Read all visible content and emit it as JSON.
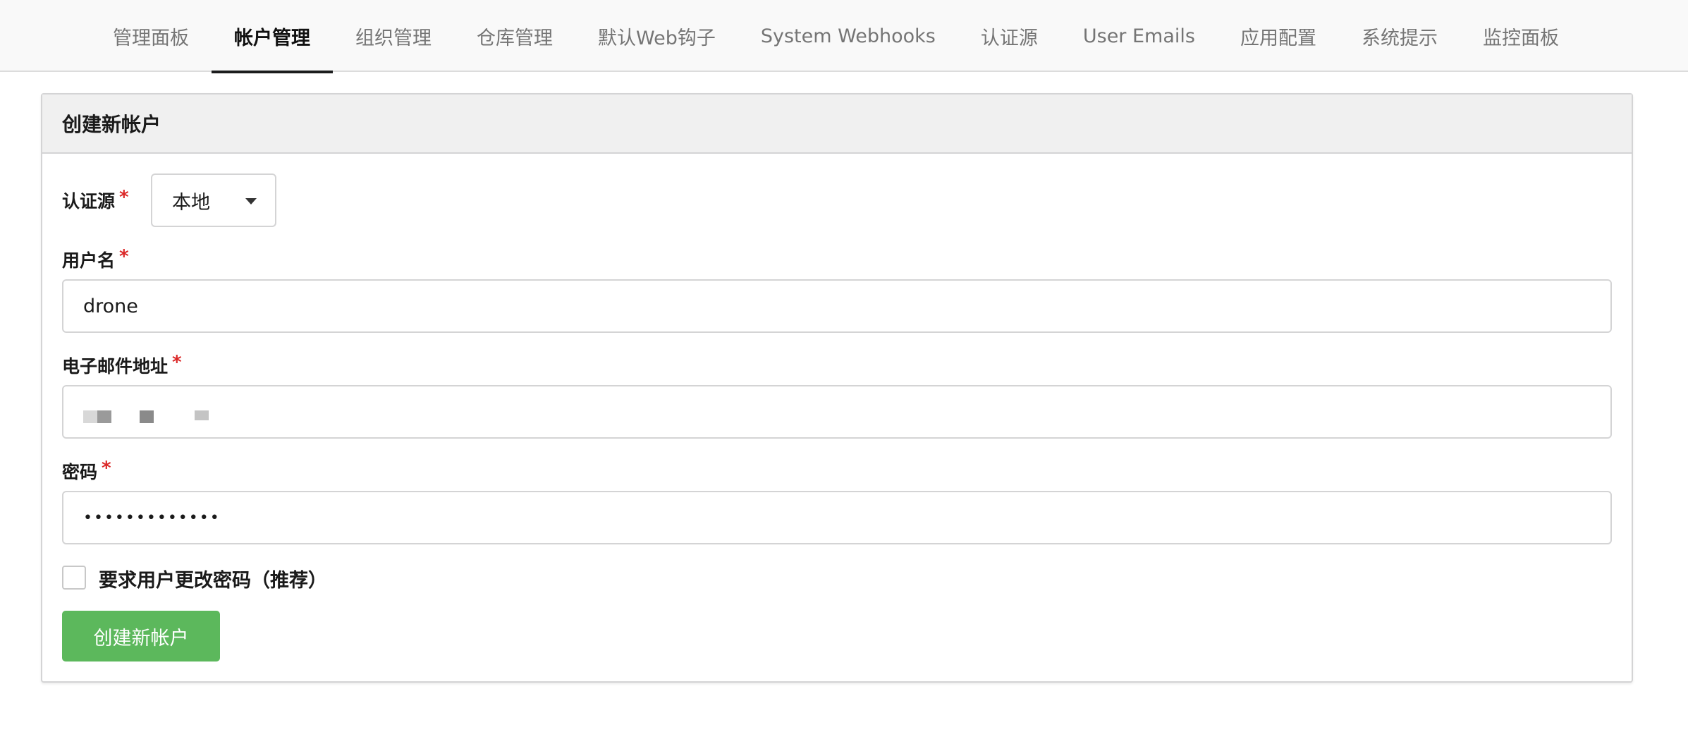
{
  "nav": {
    "tabs": [
      {
        "label": "管理面板"
      },
      {
        "label": "帐户管理",
        "active": true
      },
      {
        "label": "组织管理"
      },
      {
        "label": "仓库管理"
      },
      {
        "label": "默认Web钩子"
      },
      {
        "label": "System Webhooks"
      },
      {
        "label": "认证源"
      },
      {
        "label": "User Emails"
      },
      {
        "label": "应用配置"
      },
      {
        "label": "系统提示"
      },
      {
        "label": "监控面板"
      }
    ]
  },
  "form": {
    "title": "创建新帐户",
    "auth_source": {
      "label": "认证源",
      "value": "本地"
    },
    "username": {
      "label": "用户名",
      "value": "drone"
    },
    "email": {
      "label": "电子邮件地址",
      "value": ""
    },
    "password": {
      "label": "密码",
      "value": "•••••••••••••"
    },
    "required_marker": "*",
    "must_change_password": {
      "label": "要求用户更改密码（推荐）",
      "checked": false
    },
    "submit_label": "创建新帐户"
  },
  "colors": {
    "primary_green": "#5cb85c",
    "required_red": "#db2828",
    "active_tab_underline": "#1b1c1d"
  }
}
